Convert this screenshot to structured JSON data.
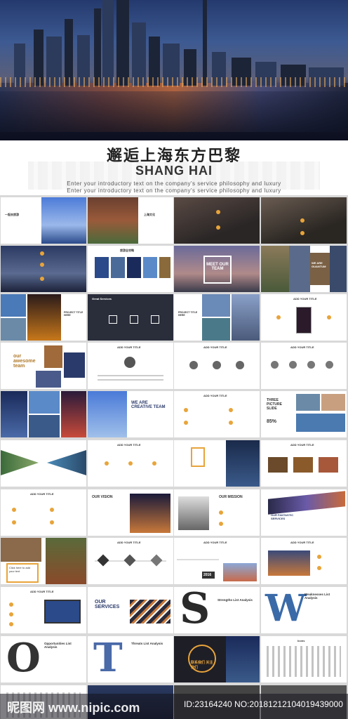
{
  "cover": {
    "title_cn": "邂逅上海东方巴黎",
    "title_en": "SHANG HAI",
    "intro_1": "Enter your introductory text on the company's service philosophy and luxury",
    "intro_2": "Enter your introductory text on the company's service philosophy and luxury"
  },
  "slides": {
    "s_cn1": "一起去旅游",
    "s_cn2": "上海文化",
    "s_travel": "旅游全攻略",
    "meet_team": "MEET OUR TEAM",
    "we_are": "WE ARE GUANTUM",
    "project_1": "PROJECT TITLE HERE",
    "great_services": "Great Services",
    "project_2": "PROJECT TITLE HERE",
    "add_title": "ADD YOUR TITLE",
    "our_awesome": "our awesome team",
    "creative_team": "WE ARE CREATIVE TEAM",
    "three_picture": "THREE PICTURE SLIDE",
    "pct_85": "85%",
    "our_vision": "OUR VISION",
    "our_mission": "OUR MISSION",
    "fantastic": "OUR FANTASTIC SERVICES",
    "click_here": "Click here to add your text",
    "year_2016": "2016",
    "our_services": "OUR SERVICES",
    "strengths": "Strengths List Analysis",
    "weaknesses": "Weaknesses List Analysis",
    "opportunities": "Opportunities List Analysis",
    "threats": "Threats List Analysis",
    "letter_s": "S",
    "letter_w": "W",
    "letter_o": "O",
    "letter_t": "T",
    "follow_cn": "联系我们 关注我们",
    "icons_label": "Icons"
  },
  "watermark": {
    "logo": "昵图网 www.nipic.com",
    "id_line": "ID:23164240 NO:20181212104019439000"
  },
  "colors": {
    "accent": "#e8a43a",
    "navy": "#2a3a6a"
  }
}
